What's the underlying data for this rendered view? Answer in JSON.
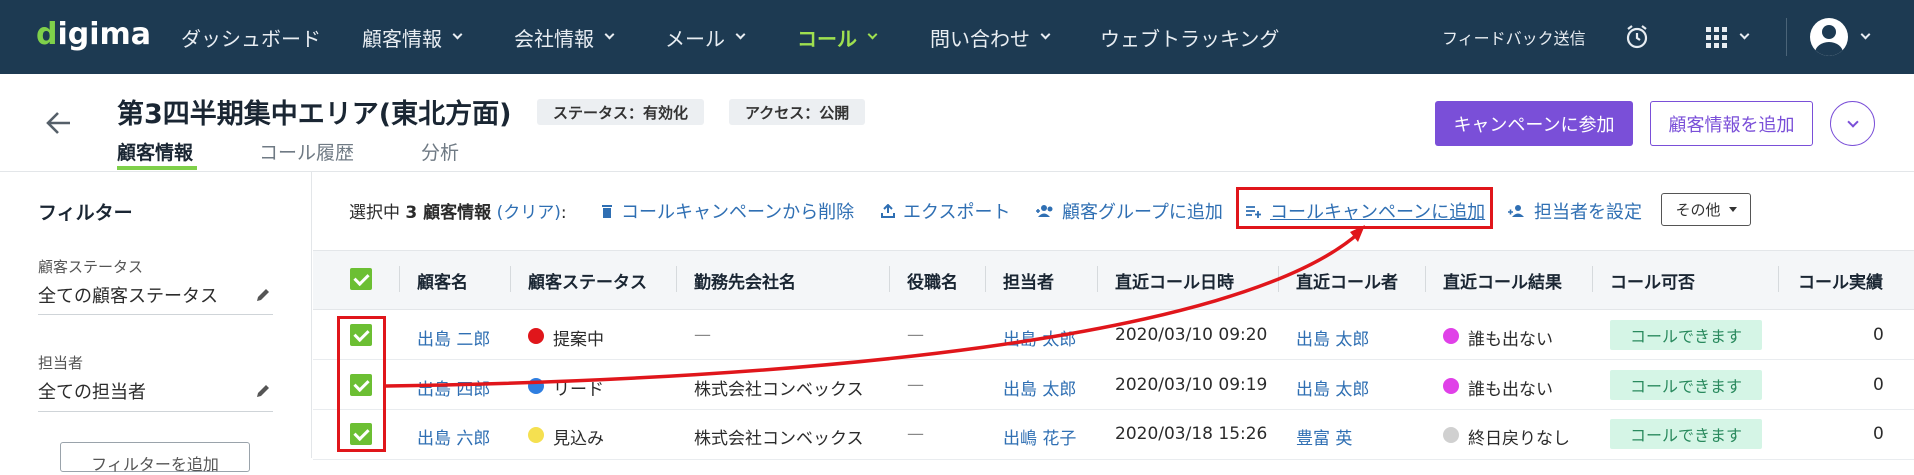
{
  "nav": {
    "logo": "digima",
    "items": [
      {
        "label": "ダッシュボード",
        "chevron": false
      },
      {
        "label": "顧客情報",
        "chevron": true
      },
      {
        "label": "会社情報",
        "chevron": true
      },
      {
        "label": "メール",
        "chevron": true
      },
      {
        "label": "コール",
        "chevron": true,
        "active": true
      },
      {
        "label": "問い合わせ",
        "chevron": true
      },
      {
        "label": "ウェブトラッキング",
        "chevron": false
      }
    ],
    "feedback": "フィードバック送信"
  },
  "header": {
    "title": "第3四半期集中エリア(東北方面)",
    "tags": [
      "ステータス：有効化",
      "アクセス：公開"
    ],
    "tabs": [
      "顧客情報",
      "コール履歴",
      "分析"
    ],
    "join_button": "キャンペーンに参加",
    "add_button": "顧客情報を追加"
  },
  "sidebar": {
    "title": "フィルター",
    "filters": [
      {
        "label": "顧客ステータス",
        "value": "全ての顧客ステータス"
      },
      {
        "label": "担当者",
        "value": "全ての担当者"
      }
    ],
    "add_filter": "フィルターを追加"
  },
  "action_bar": {
    "selected_prefix": "選択中",
    "selected_count": "3 顧客情報",
    "clear": "(クリア)",
    "colon": ":",
    "actions": [
      {
        "label": "コールキャンペーンから削除",
        "icon": "trash-icon"
      },
      {
        "label": "エクスポート",
        "icon": "export-icon"
      },
      {
        "label": "顧客グループに追加",
        "icon": "group-add-icon"
      },
      {
        "label": "コールキャンペーンに追加",
        "icon": "playlist-add-icon"
      },
      {
        "label": "担当者を設定",
        "icon": "assign-person-icon"
      }
    ],
    "other": "その他"
  },
  "table": {
    "columns": [
      "顧客名",
      "顧客ステータス",
      "勤務先会社名",
      "役職名",
      "担当者",
      "直近コール日時",
      "直近コール者",
      "直近コール結果",
      "コール可否",
      "コール実績"
    ],
    "rows": [
      {
        "name": "出島 二郎",
        "status": "提案中",
        "status_color": "#e0161b",
        "company": "—",
        "title": "—",
        "owner": "出島 太郎",
        "last_call": "2020/03/10 09:20",
        "caller": "出島 太郎",
        "result": "誰も出ない",
        "result_color": "#e040e8",
        "callable": "コールできます",
        "count": "0"
      },
      {
        "name": "出島 四郎",
        "status": "リード",
        "status_color": "#2f7ee0",
        "company": "株式会社コンベックス",
        "title": "—",
        "owner": "出島 太郎",
        "last_call": "2020/03/10 09:19",
        "caller": "出島 太郎",
        "result": "誰も出ない",
        "result_color": "#e040e8",
        "callable": "コールできます",
        "count": "0"
      },
      {
        "name": "出島 六郎",
        "status": "見込み",
        "status_color": "#f5e050",
        "company": "株式会社コンベックス",
        "title": "—",
        "owner": "出嶋 花子",
        "last_call": "2020/03/18 15:26",
        "caller": "豊富 英",
        "result": "終日戻りなし",
        "result_color": "#d0d0d0",
        "callable": "コールできます",
        "count": "0"
      }
    ]
  },
  "colors": {
    "nav_bg": "#1d3a52",
    "accent_green": "#7fd04a",
    "primary_purple": "#7a4fd8",
    "link_blue": "#2f6fb3",
    "annotation_red": "#e0161b"
  }
}
